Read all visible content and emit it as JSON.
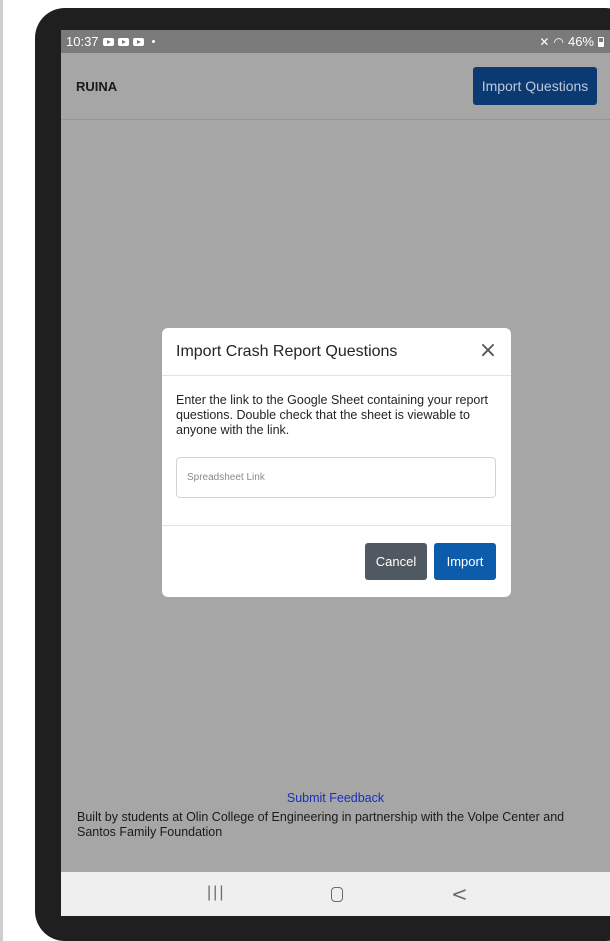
{
  "status_bar": {
    "time": "10:37",
    "battery_text": "46%"
  },
  "header": {
    "title": "RUINA",
    "import_button_label": "Import Questions"
  },
  "modal": {
    "title": "Import Crash Report Questions",
    "close_glyph": "×",
    "description": "Enter the link to the Google Sheet containing your report questions. Double check that the sheet is viewable to anyone with the link.",
    "input_placeholder": "Spreadsheet Link",
    "cancel_label": "Cancel",
    "import_label": "Import"
  },
  "footer": {
    "feedback_link": "Submit Feedback",
    "credit": "Built by students at Olin College of Engineering in partnership with the Volpe Center and Santos Family Foundation"
  },
  "nav_bar": {
    "recent_glyph": "|||",
    "back_glyph": "<"
  },
  "colors": {
    "primary_button": "#0d5cab",
    "secondary_button": "#505861",
    "overlay": "#a6a6a6"
  }
}
